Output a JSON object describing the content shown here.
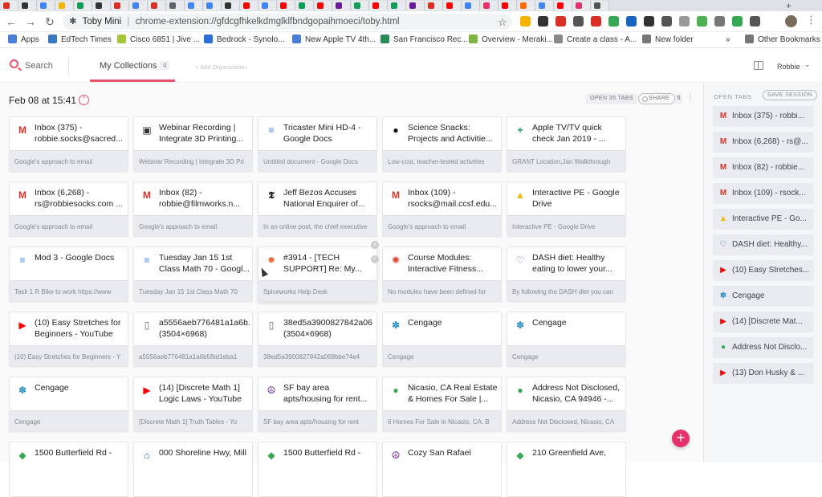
{
  "browser": {
    "title_tab": "Toby Mini",
    "url": "chrome-extension://gfdcgfhkelkdmglklfbndgopaihmoeci/toby.html",
    "back_glyph": "←",
    "forward_glyph": "→",
    "reload_glyph": "↻",
    "star_glyph": "☆",
    "menu_glyph": "⋮",
    "new_tab_glyph": "+"
  },
  "bookmarks": [
    {
      "label": "Apps",
      "icon": "apps-icon",
      "color": "#4a7fd8"
    },
    {
      "label": "EdTech Times",
      "icon": "edtech-icon",
      "color": "#3b78c4"
    },
    {
      "label": "Cisco 6851 | Jive ...",
      "icon": "cisco-icon",
      "color": "#a4c639"
    },
    {
      "label": "Bedrock - Synolo...",
      "icon": "bedrock-icon",
      "color": "#2a6fd8"
    },
    {
      "label": "New Apple TV 4th...",
      "icon": "page-icon",
      "color": "#4a7fd8"
    },
    {
      "label": "San Francisco Rec...",
      "icon": "sf-icon",
      "color": "#2a8a5a"
    },
    {
      "label": "Overview - Meraki...",
      "icon": "meraki-icon",
      "color": "#7cb342"
    },
    {
      "label": "Create a class - A...",
      "icon": "doc-icon",
      "color": "#888888"
    },
    {
      "label": "New folder",
      "icon": "folder-icon",
      "color": "#777777"
    },
    {
      "label": "»",
      "icon": "overflow-icon",
      "color": "#555555"
    },
    {
      "label": "Other Bookmarks",
      "icon": "folder-icon",
      "color": "#777777"
    }
  ],
  "toby": {
    "search_label": "Search",
    "collections_tab": "My Collections",
    "collections_count": "4",
    "add_org": "+ Add Organization",
    "user": "Robbie",
    "user_chevron": "⌄",
    "session_title": "Feb 08 at 15:41",
    "session_toggle_glyph": "⌃",
    "open_tabs_btn": "OPEN 35 TABS",
    "share_btn": "SHARE",
    "sort_glyph": "⇅",
    "more_glyph": "⋮",
    "fab_glyph": "+",
    "close_glyph": "×",
    "check_glyph": "✓"
  },
  "cards": [
    {
      "title": "Inbox (375) - robbie.socks@sacred...",
      "sub": "Google's approach to email",
      "icon": "gmail-icon",
      "glyph": "M",
      "color": "#d93025"
    },
    {
      "title": "Webinar Recording | Integrate 3D Printing...",
      "sub": "Webinar Recording | Integrate 3D Pri",
      "icon": "webinar-icon",
      "glyph": "▣",
      "color": "#333333"
    },
    {
      "title": "Tricaster Mini HD-4 - Google Docs",
      "sub": "Untitled document - Google Docs",
      "icon": "google-docs-icon",
      "glyph": "≡",
      "color": "#4285f4"
    },
    {
      "title": "Science Snacks: Projects and Activitie...",
      "sub": "Low-cost, teacher-tested activities",
      "icon": "exploratorium-icon",
      "glyph": "●",
      "color": "#111111"
    },
    {
      "title": "Apple TV/TV quick check Jan 2019 - ...",
      "sub": "GRANT Location,Jan Walkthrough",
      "icon": "google-sheets-icon",
      "glyph": "+",
      "color": "#0f9d58"
    },
    {
      "title": "Inbox (6,268) - rs@robbiesocks.com ...",
      "sub": "Google's approach to email",
      "icon": "gmail-icon",
      "glyph": "M",
      "color": "#d93025"
    },
    {
      "title": "Inbox (82) - robbie@filmworks.n...",
      "sub": "Google's approach to email",
      "icon": "gmail-icon",
      "glyph": "M",
      "color": "#d93025"
    },
    {
      "title": "Jeff Bezos Accuses National Enquirer of...",
      "sub": "In an online post, the chief executive",
      "icon": "nytimes-icon",
      "glyph": "𝕿",
      "color": "#111111"
    },
    {
      "title": "Inbox (109) - rsocks@mail.ccsf.edu...",
      "sub": "Google's approach to email",
      "icon": "gmail-icon",
      "glyph": "M",
      "color": "#d93025"
    },
    {
      "title": "Interactive PE - Google Drive",
      "sub": "Interactive PE - Google Drive",
      "icon": "google-drive-icon",
      "glyph": "▲",
      "color": "#f4b400"
    },
    {
      "title": "Mod 3 - Google Docs",
      "sub": "Task 1 R Bike to work https://www",
      "icon": "google-docs-icon",
      "glyph": "≡",
      "color": "#4285f4"
    },
    {
      "title": "Tuesday Jan 15 1st Class Math 70 - Googl...",
      "sub": "Tuesday Jan 15 1st Class Math 70",
      "icon": "google-docs-icon",
      "glyph": "≡",
      "color": "#4285f4"
    },
    {
      "title": "#3914 - [TECH SUPPORT] Re: My...",
      "sub": "Spiceworks Help Desk",
      "icon": "spiceworks-icon",
      "glyph": "✸",
      "color": "#f06a35"
    },
    {
      "title": "Course Modules: Interactive Fitness...",
      "sub": "No modules have been defined for",
      "icon": "canvas-icon",
      "glyph": "✺",
      "color": "#e03e2d"
    },
    {
      "title": "DASH diet: Healthy eating to lower your...",
      "sub": "By following the DASH diet you can",
      "icon": "mayo-clinic-icon",
      "glyph": "♡",
      "color": "#3a6fb0"
    },
    {
      "title": "(10) Easy Stretches for Beginners - YouTube",
      "sub": "(10) Easy Stretches for Beginners - Y",
      "icon": "youtube-icon",
      "glyph": "▶",
      "color": "#ff0000"
    },
    {
      "title": "a5556aeb776481a1a6b... (3504×6968)",
      "sub": "a5556aeb776481a1a6b5fbd1eba1",
      "icon": "file-icon",
      "glyph": "▯",
      "color": "#666666"
    },
    {
      "title": "38ed5a3900827842a06 (3504×6968)",
      "sub": "38ed5a3900827842a069bbe74e4",
      "icon": "file-icon",
      "glyph": "▯",
      "color": "#666666"
    },
    {
      "title": "Cengage",
      "sub": "Cengage",
      "icon": "cengage-icon",
      "glyph": "✽",
      "color": "#1f8ac0"
    },
    {
      "title": "Cengage",
      "sub": "Cengage",
      "icon": "cengage-icon",
      "glyph": "✽",
      "color": "#1f8ac0"
    },
    {
      "title": "Cengage",
      "sub": "Cengage",
      "icon": "cengage-icon",
      "glyph": "✽",
      "color": "#1f8ac0"
    },
    {
      "title": "(14) [Discrete Math 1] Logic Laws - YouTube",
      "sub": "[Discrete Math 1] Truth Tables - Yo",
      "icon": "youtube-icon",
      "glyph": "▶",
      "color": "#ff0000"
    },
    {
      "title": "SF bay area apts/housing for rent...",
      "sub": "SF bay area apts/housing for rent",
      "icon": "craigslist-icon",
      "glyph": "☮",
      "color": "#6a1b9a"
    },
    {
      "title": "Nicasio, CA Real Estate & Homes For Sale |...",
      "sub": "6 Homes For Sale in Nicasio, CA. B",
      "icon": "map-pin-icon",
      "glyph": "●",
      "color": "#34a853"
    },
    {
      "title": "Address Not Disclosed, Nicasio, CA 94946 -...",
      "sub": "Address Not Disclosed, Nicasio, CA",
      "icon": "map-pin-icon",
      "glyph": "●",
      "color": "#34a853"
    },
    {
      "title": "1500 Butterfield Rd -",
      "sub": "",
      "icon": "google-maps-icon",
      "glyph": "◆",
      "color": "#34a853"
    },
    {
      "title": "000 Shoreline Hwy, Mill",
      "sub": "",
      "icon": "redfin-icon",
      "glyph": "⌂",
      "color": "#1565c0"
    },
    {
      "title": "1500 Butterfield Rd -",
      "sub": "",
      "icon": "google-maps-icon",
      "glyph": "◆",
      "color": "#34a853"
    },
    {
      "title": "Cozy San Rafael",
      "sub": "",
      "icon": "craigslist-icon",
      "glyph": "☮",
      "color": "#6a1b9a"
    },
    {
      "title": "210 Greenfield Ave,",
      "sub": "",
      "icon": "google-maps-icon",
      "glyph": "◆",
      "color": "#34a853"
    }
  ],
  "sidebar": {
    "title": "OPEN TABS",
    "save_label": "SAVE SESSION",
    "items": [
      {
        "label": "Inbox (375) - robbi...",
        "icon": "gmail-icon",
        "glyph": "M",
        "color": "#d93025"
      },
      {
        "label": "Inbox (6,268) - rs@...",
        "icon": "gmail-icon",
        "glyph": "M",
        "color": "#d93025"
      },
      {
        "label": "Inbox (82) - robbie...",
        "icon": "gmail-icon",
        "glyph": "M",
        "color": "#d93025"
      },
      {
        "label": "Inbox (109) - rsock...",
        "icon": "gmail-icon",
        "glyph": "M",
        "color": "#d93025"
      },
      {
        "label": "Interactive PE - Go...",
        "icon": "google-drive-icon",
        "glyph": "▲",
        "color": "#f4b400"
      },
      {
        "label": "DASH diet: Healthy...",
        "icon": "mayo-clinic-icon",
        "glyph": "♡",
        "color": "#3a6fb0"
      },
      {
        "label": "(10) Easy Stretches...",
        "icon": "youtube-icon",
        "glyph": "▶",
        "color": "#ff0000"
      },
      {
        "label": "Cengage",
        "icon": "cengage-icon",
        "glyph": "✽",
        "color": "#1f8ac0"
      },
      {
        "label": "(14) [Discrete Mat...",
        "icon": "youtube-icon",
        "glyph": "▶",
        "color": "#ff0000"
      },
      {
        "label": "Address Not Disclo...",
        "icon": "map-pin-icon",
        "glyph": "●",
        "color": "#34a853"
      },
      {
        "label": "(13) Don Husky & ...",
        "icon": "youtube-icon",
        "glyph": "▶",
        "color": "#ff0000"
      }
    ]
  },
  "colors": {
    "accent": "#e8546b",
    "fab": "#e5326a"
  },
  "tab_icons": [
    "#d93025",
    "#333333",
    "#4285f4",
    "#f4b400",
    "#0f9d58",
    "#333333",
    "#d93025",
    "#4285f4",
    "#d93025",
    "#5f6368",
    "#4285f4",
    "#4285f4",
    "#333333",
    "#ff0000",
    "#4285f4",
    "#ff0000",
    "#0f9d58",
    "#ff0000",
    "#6a1b9a",
    "#0f9d58",
    "#ff0000",
    "#0f9d58",
    "#6a1b9a",
    "#d93025",
    "#ff0000",
    "#4285f4",
    "#e5326a",
    "#ff0000",
    "#ff6d00",
    "#4285f4",
    "#ff0000",
    "#e5326a",
    "#555555"
  ],
  "ext_icons": [
    "#f4b400",
    "#333333",
    "#d93025",
    "#555555",
    "#d93025",
    "#34a853",
    "#1565c0",
    "#333333",
    "#555555",
    "#999999",
    "#4caf50",
    "#777777",
    "#34a853",
    "#555555"
  ]
}
